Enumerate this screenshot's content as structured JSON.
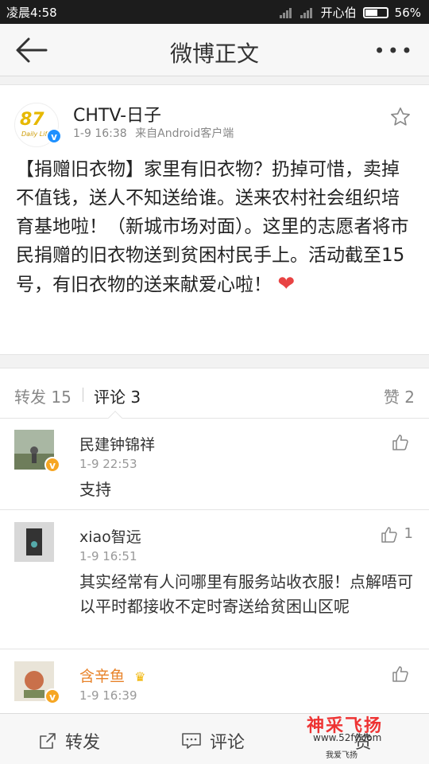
{
  "status": {
    "time": "凌晨4:58",
    "carrier": "开心伯",
    "battery": "56%",
    "battery_level": 0.56
  },
  "nav": {
    "title": "微博正文",
    "back_icon": "back-arrow-icon",
    "more_icon": "more-dots-icon"
  },
  "post": {
    "author": "CHTV-日子",
    "time": "1-9 16:38",
    "source": "来自Android客户端",
    "content": "【捐赠旧衣物】家里有旧衣物？扔掉可惜，卖掉不值钱，送人不知送给谁。送来农村社会组织培育基地啦！（新城市场对面）。这里的志愿者将市民捐赠的旧衣物送到贫困村民手上。活动截至15号，有旧衣物的送来献爱心啦！",
    "emoji": "❤",
    "avatar_logo": "87",
    "avatar_logo_sub": "Daily Life"
  },
  "tabs": {
    "repost": "转发 15",
    "comment": "评论 3",
    "like": "赞 2"
  },
  "comments": [
    {
      "name": "民建钟锦祥",
      "time": "1-9 22:53",
      "text": "支持",
      "likes": ""
    },
    {
      "name": "xiao智远",
      "time": "1-9 16:51",
      "text": "其实经常有人问哪里有服务站收衣服！点解唔可以平时都接收不定时寄送给贫困山区呢",
      "likes": "1"
    },
    {
      "name": "含辛鱼",
      "time": "1-9 16:39",
      "text": "",
      "likes": ""
    }
  ],
  "bottom": {
    "repost": "转发",
    "comment": "评论",
    "like": "赞"
  },
  "watermark": {
    "line1": "神采飞扬",
    "line2": "www.52fy.com",
    "line3": "我爱飞扬"
  },
  "colors": {
    "verified_blue": "#1e90ff",
    "verified_gold": "#f6a623",
    "heart": "#e84343"
  }
}
